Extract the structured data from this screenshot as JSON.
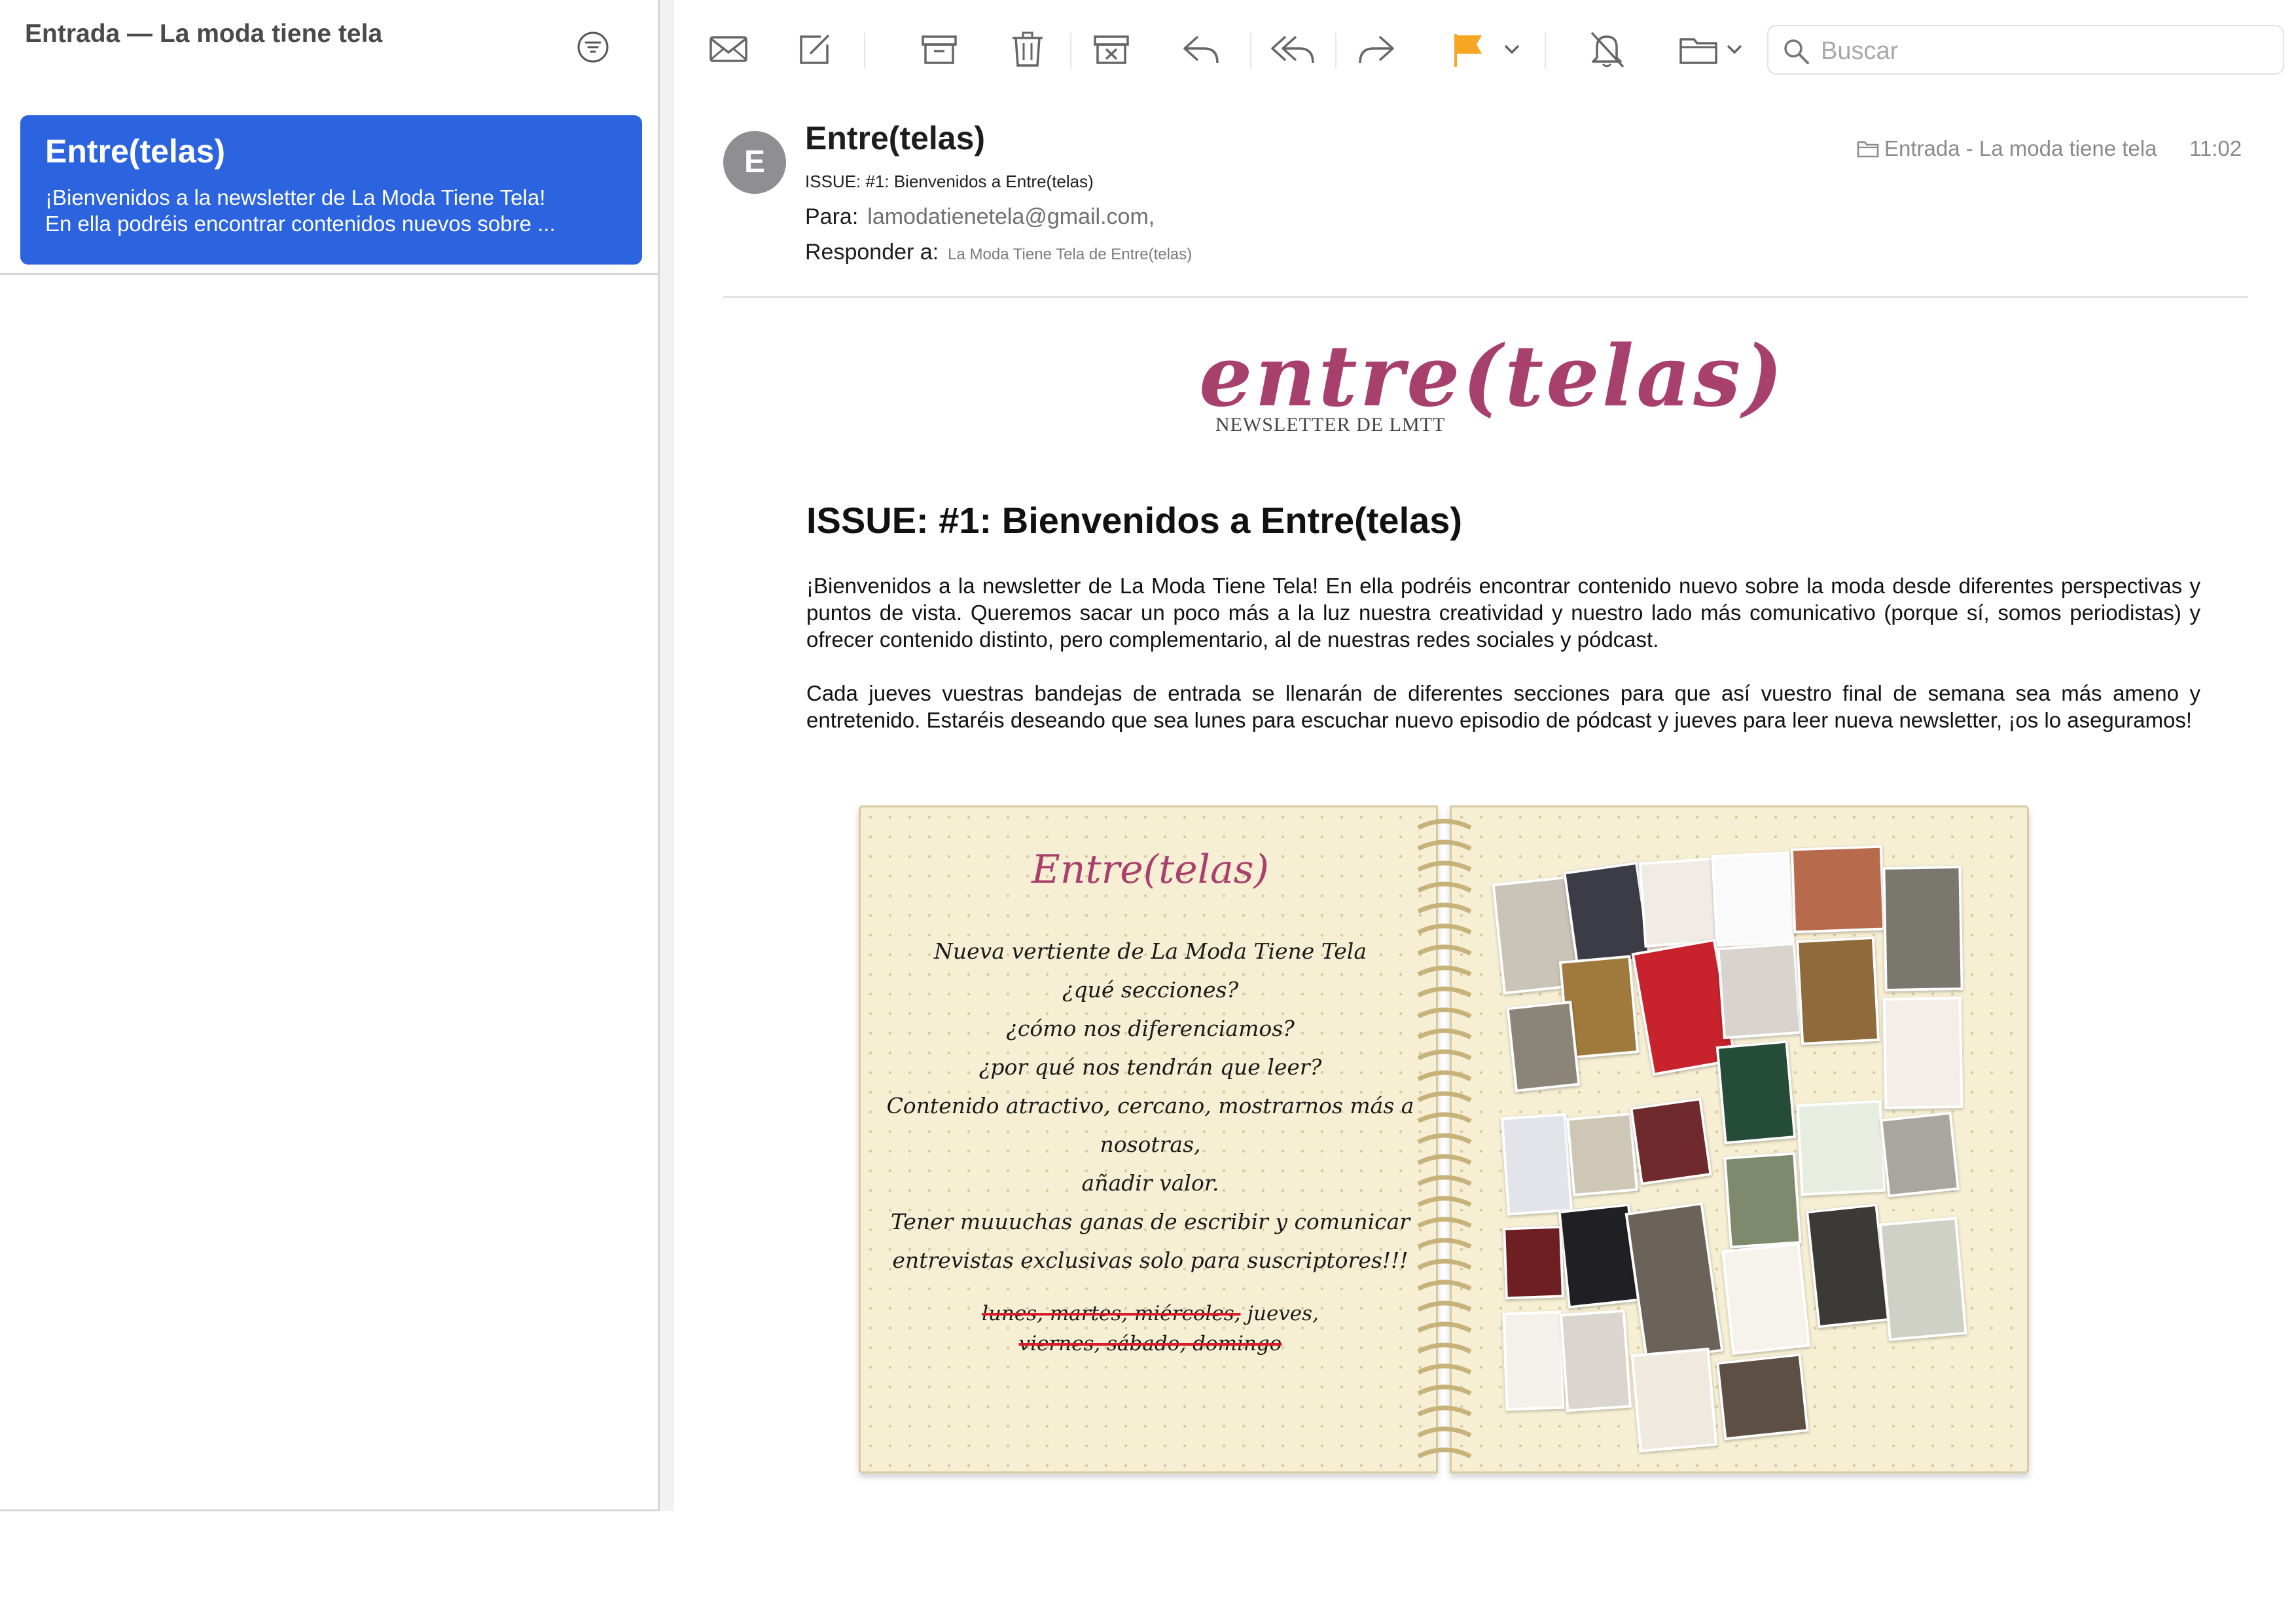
{
  "sidebar": {
    "title": "Entrada — La moda tiene tela",
    "messages": [
      {
        "sender": "Entre(telas)",
        "preview_line1": "¡Bienvenidos a la newsletter de La Moda Tiene Tela!",
        "preview_line2": "En ella podréis encontrar contenidos nuevos sobre ..."
      }
    ]
  },
  "toolbar": {
    "icons": [
      "envelope-icon",
      "compose-icon",
      "archive-icon",
      "trash-icon",
      "junk-icon",
      "reply-icon",
      "reply-all-icon",
      "forward-icon",
      "flag-icon",
      "chevron-down-icon",
      "mute-bell-icon",
      "folder-icon"
    ],
    "flag_color": "#f5a623",
    "search_placeholder": "Buscar"
  },
  "message": {
    "avatar_initial": "E",
    "sender": "Entre(telas)",
    "subject": "ISSUE: #1: Bienvenidos a Entre(telas)",
    "to_label": "Para:",
    "to_value": "lamodatienetela@gmail.com,",
    "reply_label": "Responder a:",
    "reply_value": "La Moda Tiene Tela de Entre(telas)",
    "folder": "Entrada - La moda tiene tela",
    "time": "11:02"
  },
  "newsletter": {
    "logo": "entre(telas)",
    "logo_subtitle": "NEWSLETTER DE LMTT",
    "title": "ISSUE: #1: Bienvenidos a Entre(telas)",
    "paragraph1": "¡Bienvenidos a la newsletter de La Moda Tiene Tela! En ella podréis encontrar contenido nuevo sobre la moda desde diferentes perspectivas y puntos de vista. Queremos sacar un poco más a la luz nuestra creatividad y nuestro lado más comunicativo (porque sí, somos periodistas) y ofrecer contenido distinto, pero complementario, al de nuestras redes sociales y pódcast.",
    "paragraph2": "Cada jueves vuestras bandejas de entrada se llenarán de diferentes secciones para que así vuestro final de semana sea más ameno y entretenido. Estaréis deseando que sea lunes para escuchar nuevo episodio de pódcast y jueves para leer nueva newsletter, ¡os lo aseguramos!",
    "notebook": {
      "title": "Entre(telas)",
      "lines": [
        "Nueva vertiente de La Moda Tiene Tela",
        "¿qué secciones?",
        "¿cómo nos diferenciamos?",
        "¿por qué nos tendrán que leer?",
        "Contenido atractivo, cercano, mostrarnos más a nosotras,",
        "añadir valor.",
        "Tener muuuchas ganas de escribir y comunicar",
        "entrevistas exclusivas solo para suscriptores!!!"
      ],
      "days_struck_1": "lunes, martes, miércoles,",
      "days_kept": "jueves,",
      "days_struck_2": "viernes, sábado, domingo"
    }
  }
}
